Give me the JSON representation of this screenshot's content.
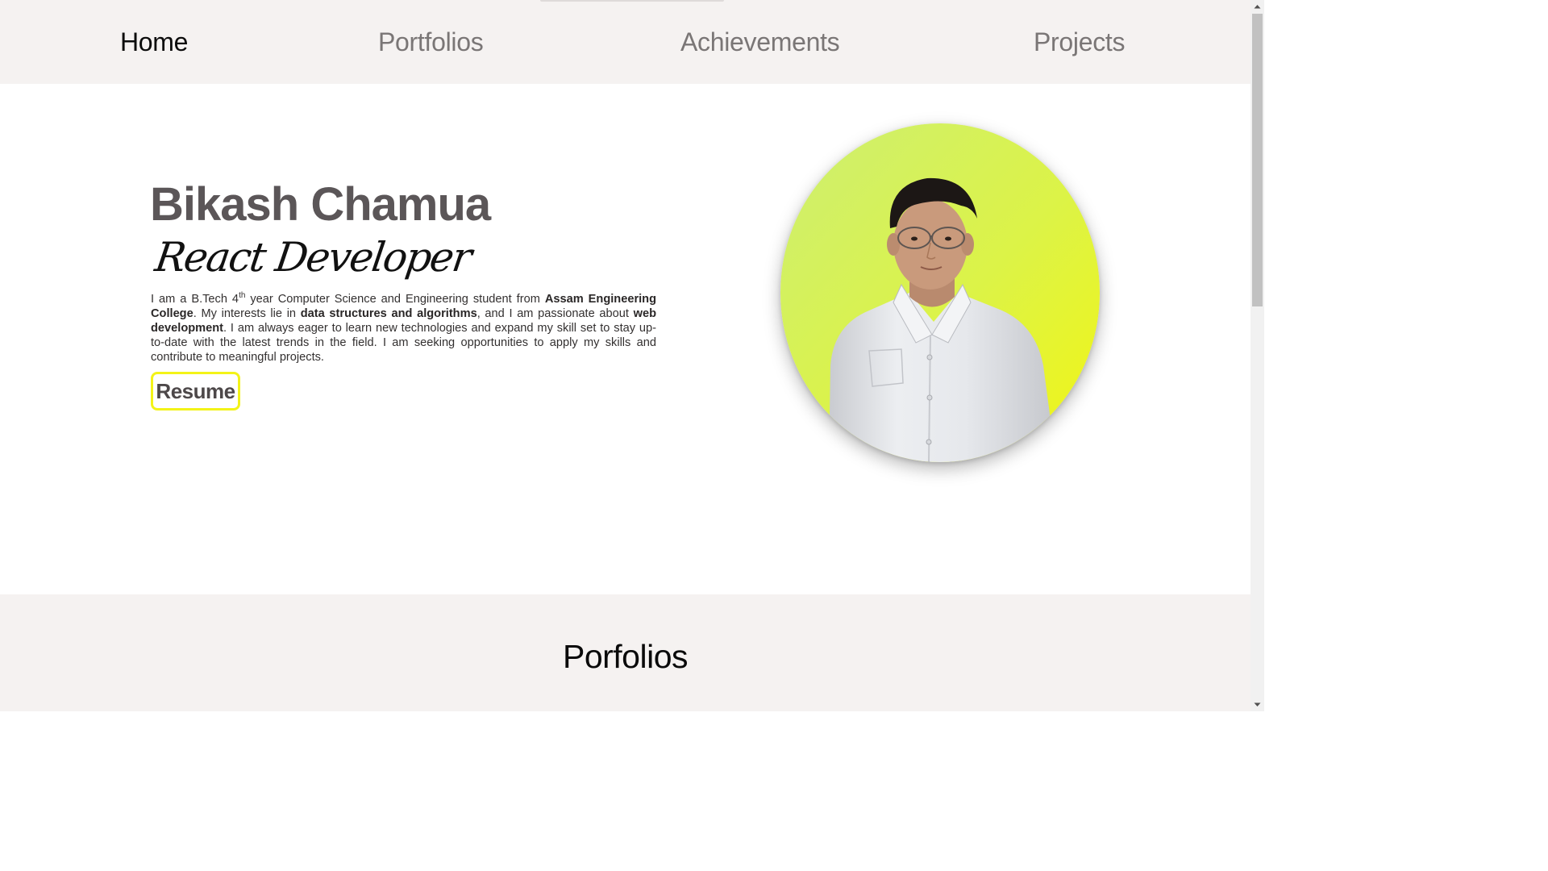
{
  "nav": {
    "items": [
      {
        "label": "Home",
        "active": true
      },
      {
        "label": "Portfolios",
        "active": false
      },
      {
        "label": "Achievements",
        "active": false
      },
      {
        "label": "Projects",
        "active": false
      }
    ]
  },
  "hero": {
    "name": "Bikash Chamua",
    "role": "React Developer",
    "bio": {
      "p1": "I am a B.Tech 4",
      "sup": "th",
      "p2": " year Computer Science and Engineering student from ",
      "college": "Assam Engineering College",
      "p3": ". My interests lie in ",
      "interest": "data structures and algorithms",
      "p4": ", and I am passionate about ",
      "passion": "web development",
      "p5": ". I am always eager to learn new technologies and expand my skill set to stay up-to-date with the latest trends in the field. I am seeking opportunities to apply my skills and contribute to meaningful projects."
    },
    "resume_label": "Resume"
  },
  "portfolio": {
    "heading": "Porfolios"
  },
  "colors": {
    "nav_bg": "#f5f2f1",
    "name_color": "#5b5658",
    "resume_border": "#f3f318",
    "photo_bg_start": "#d2f06a",
    "photo_bg_end": "#f0f51a"
  },
  "icons": {
    "scroll_up": "triangle-up-icon",
    "scroll_down": "triangle-down-icon"
  }
}
